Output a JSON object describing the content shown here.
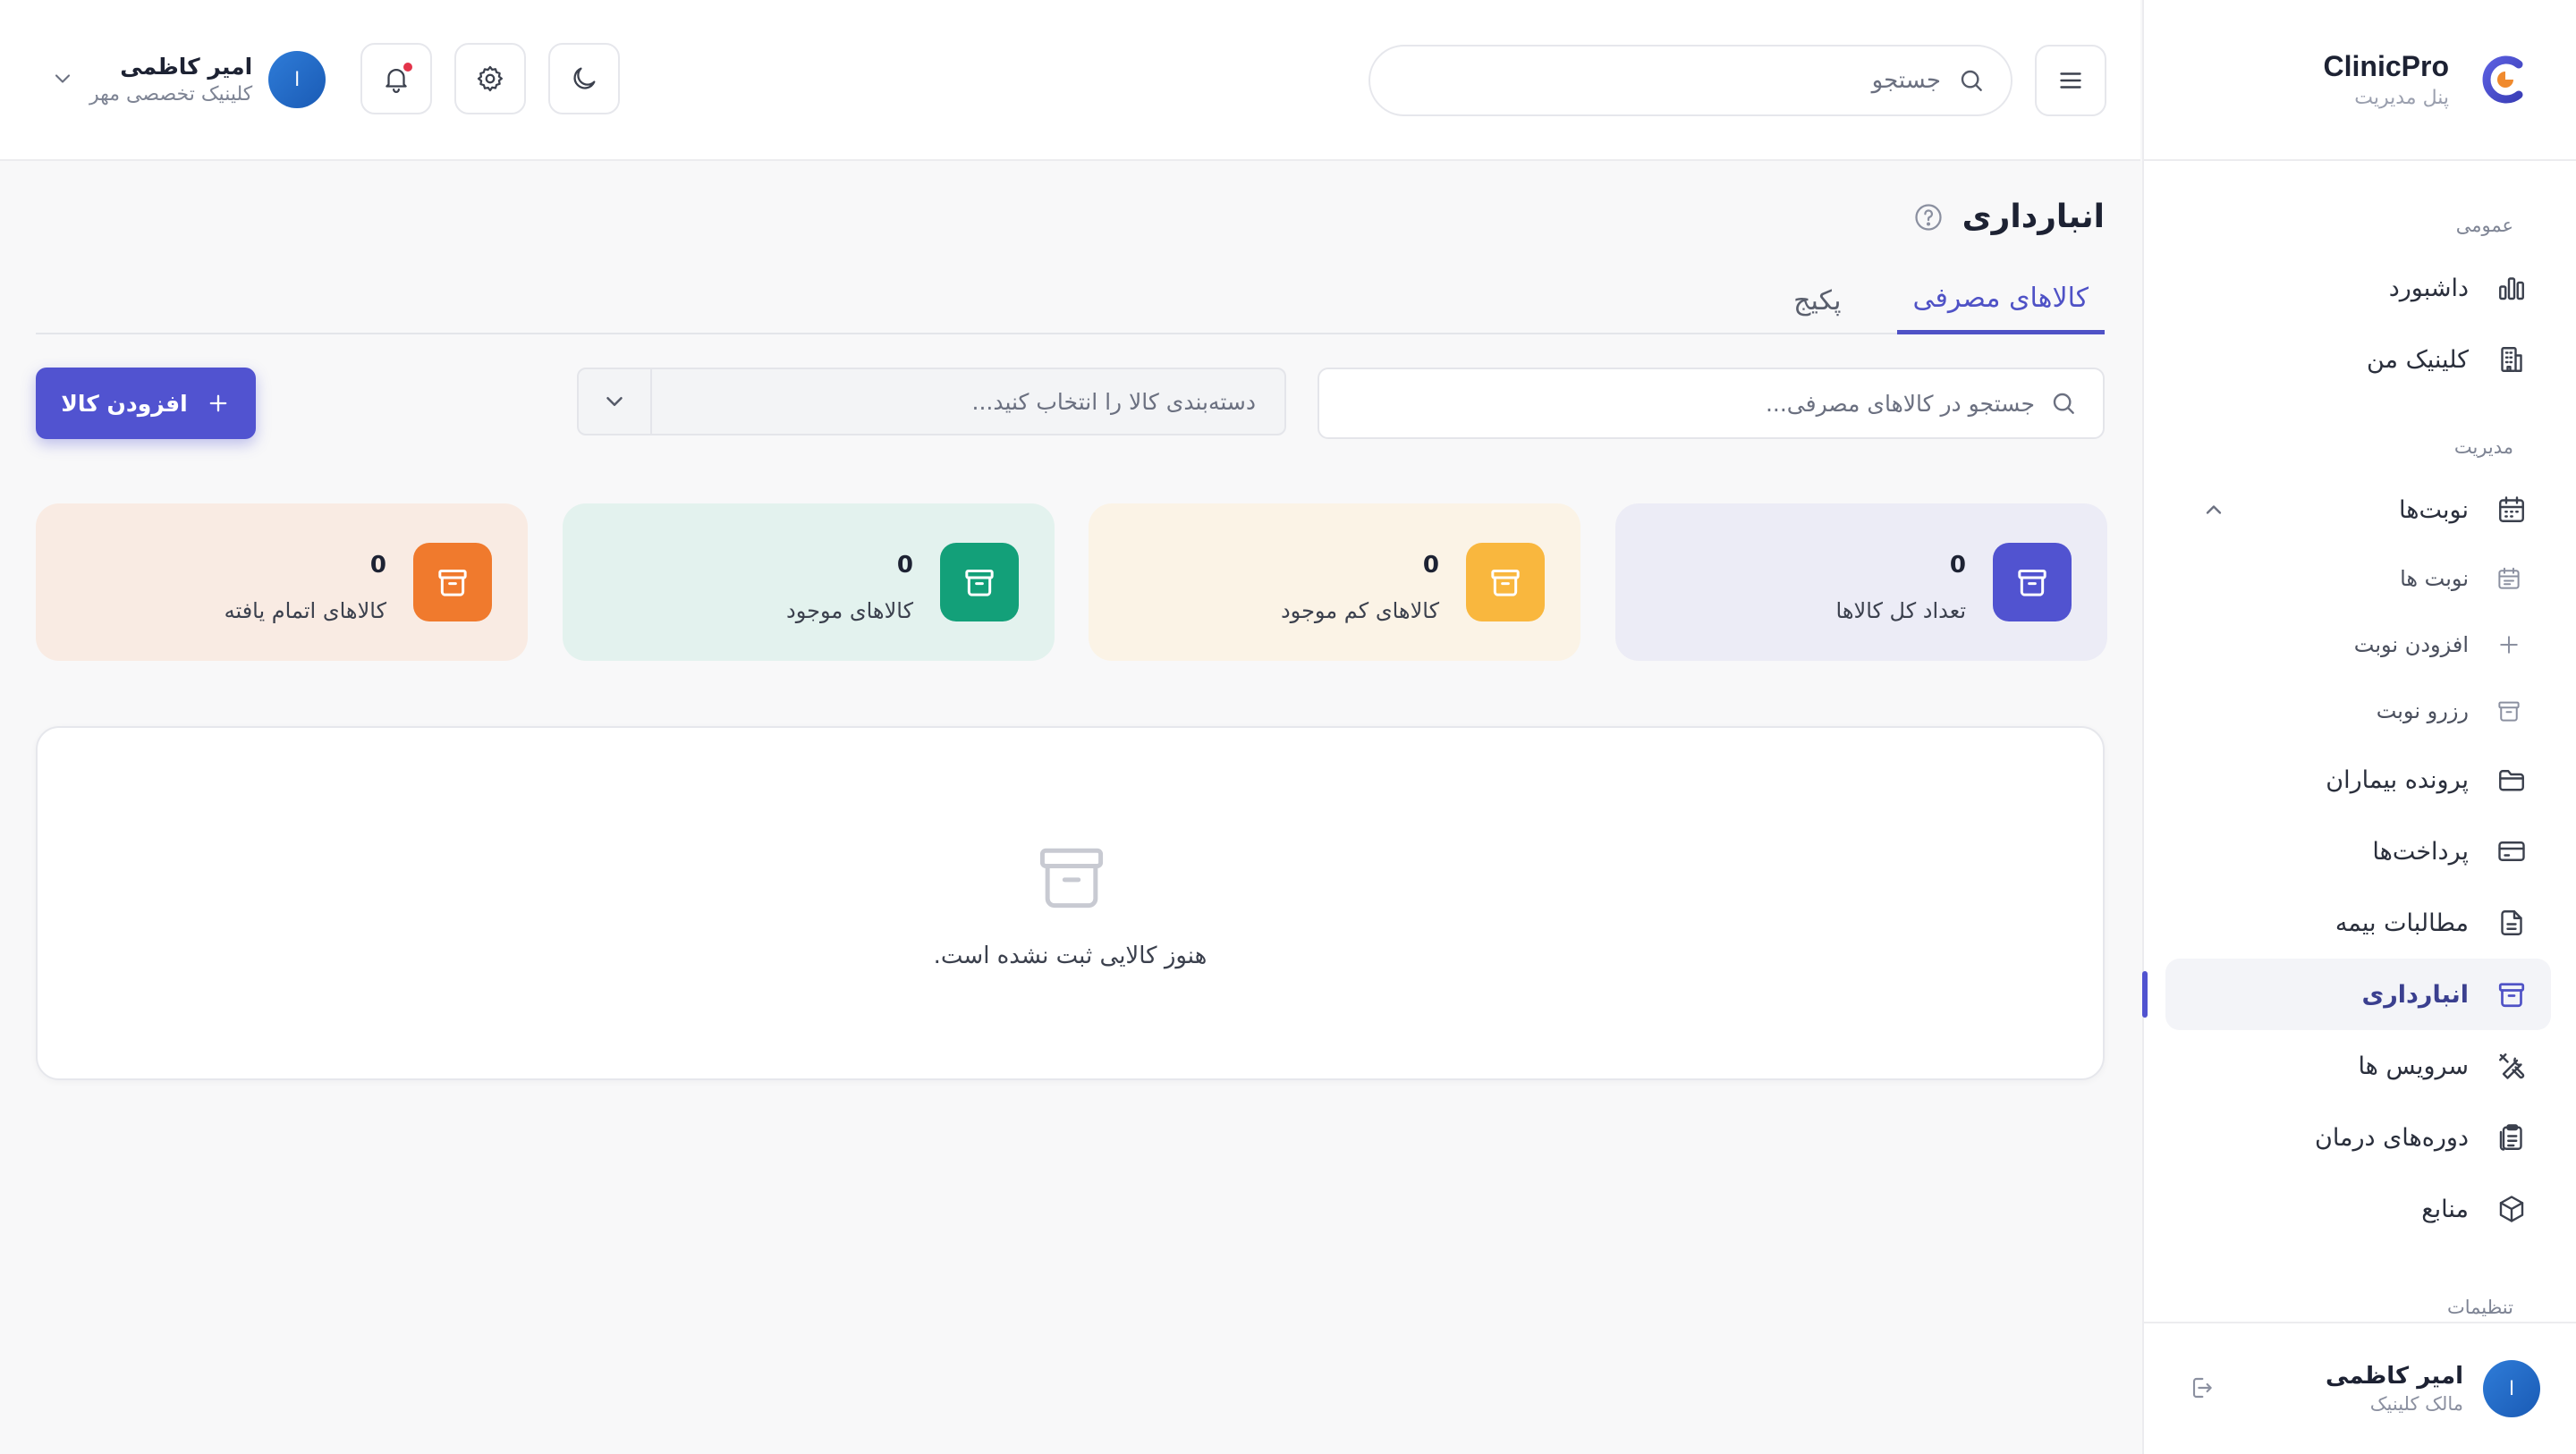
{
  "brand": {
    "name": "ClinicPro",
    "subtitle": "پنل مدیریت"
  },
  "sidebar": {
    "sections": {
      "general": "عمومی",
      "management": "مدیریت",
      "settings": "تنظیمات"
    },
    "items": {
      "dashboard": "داشبورد",
      "my_clinic": "کلینیک من",
      "appointments": "نوبت‌ها",
      "appointments_list": "نوبت ها",
      "add_appointment": "افزودن نوبت",
      "reserve_appointment": "رزرو نوبت",
      "patient_records": "پرونده بیماران",
      "payments": "پرداخت‌ها",
      "insurance_claims": "مطالبات بیمه",
      "inventory": "انبارداری",
      "services": "سرویس ها",
      "treatment_courses": "دوره‌های درمان",
      "resources": "منابع"
    },
    "user": {
      "name": "امیر کاظمی",
      "role": "مالک کلینیک",
      "initial": "ا"
    }
  },
  "topbar": {
    "search_placeholder": "جستجو",
    "user": {
      "name": "امیر کاظمی",
      "clinic": "کلینیک تخصصی مهر",
      "initial": "ا"
    }
  },
  "page": {
    "title": "انبارداری",
    "tabs": [
      "کالاهای مصرفی",
      "پکیج"
    ],
    "active_tab": 0,
    "search_placeholder": "جستجو در کالاهای مصرفی...",
    "category_placeholder": "دسته‌بندی کالا را انتخاب کنید...",
    "add_button": "افزودن کالا",
    "stats": [
      {
        "label": "تعداد کل کالاها",
        "value": "0",
        "color": "#5153d0",
        "bg": "#ececf6"
      },
      {
        "label": "کالاهای کم موجود",
        "value": "0",
        "color": "#f9b73e",
        "bg": "#fbf3e6"
      },
      {
        "label": "کالاهای موجود",
        "value": "0",
        "color": "#13a079",
        "bg": "#e3f2ee"
      },
      {
        "label": "کالاهای اتمام یافته",
        "value": "0",
        "color": "#f07a2d",
        "bg": "#f9ebe3"
      }
    ],
    "empty_text": "هنوز کالایی ثبت نشده است."
  }
}
